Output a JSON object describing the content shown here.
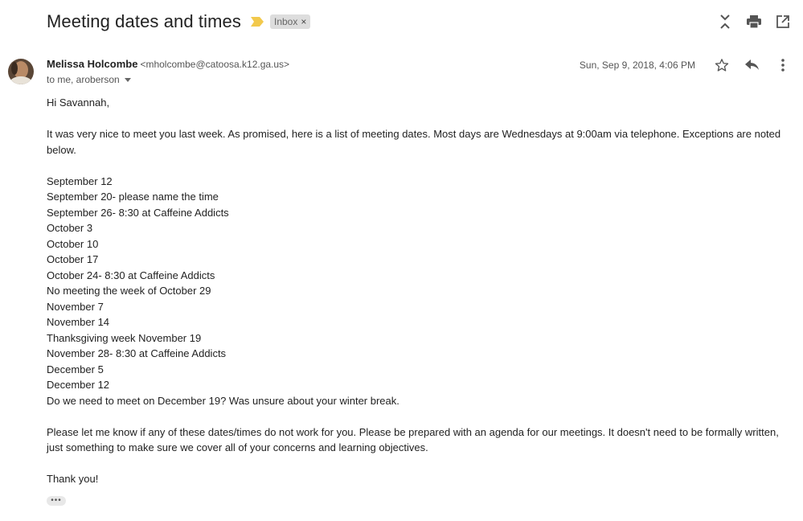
{
  "subject": "Meeting dates and times",
  "label": {
    "text": "Inbox",
    "remove_glyph": "×"
  },
  "top_actions": [
    "collapse-all-icon",
    "print-icon",
    "open-in-new-window-icon"
  ],
  "sender": {
    "name": "Melissa Holcombe",
    "email": "<mholcombe@catoosa.k12.ga.us>",
    "recipients": "to me, aroberson",
    "date": "Sun, Sep 9, 2018, 4:06 PM"
  },
  "message_actions": [
    "star-icon",
    "reply-icon",
    "more-vert-icon"
  ],
  "body": {
    "greeting": "Hi Savannah,",
    "intro": "It was very nice to meet you last week.  As promised, here is a list of meeting dates.  Most days are Wednesdays at 9:00am via telephone.  Exceptions are noted below.",
    "dates": [
      "September 12",
      "September 20- please name the time",
      "September 26- 8:30 at Caffeine Addicts",
      "October 3",
      "October 10",
      "October 17",
      "October 24- 8:30 at Caffeine Addicts",
      "No meeting the week of October 29",
      "November 7",
      "November 14",
      "Thanksgiving week November 19",
      "November 28- 8:30 at Caffeine Addicts",
      "December 5",
      "December 12",
      "Do we need to meet on December 19?  Was unsure about your winter break."
    ],
    "closing_paragraph": "Please let me know if any of these dates/times do not work for you.  Please be prepared with an agenda for our meetings.  It doesn't need to be formally written, just something to make sure we cover all of your concerns and learning objectives.",
    "signoff": "Thank you!"
  },
  "colors": {
    "important_marker": "#f2c94c",
    "label_bg": "#dddddd"
  }
}
